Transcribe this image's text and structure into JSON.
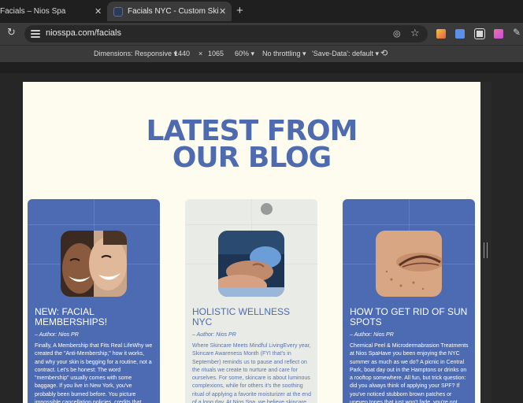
{
  "browser": {
    "tabs": [
      {
        "title": "Facials – Nios Spa",
        "active": false
      },
      {
        "title": "Facials NYC - Custom Skincare & Spa",
        "active": true
      }
    ],
    "address": "niosspa.com/facials"
  },
  "devtools_bar": {
    "dimensions_label": "Dimensions: Responsive ▾",
    "width": "1440",
    "times": "×",
    "height": "1065",
    "zoom": "60% ▾",
    "throttling": "No throttling ▾",
    "save_data": "'Save-Data': default ▾"
  },
  "page": {
    "heading_line1": "LATEST FROM",
    "heading_line2": "OUR BLOG",
    "cards": [
      {
        "title": "NEW: FACIAL MEMBERSHIPS!",
        "author": "– Author: Nios PR",
        "body": "Finally, A Membership that Fits Real LifeWhy we created the \"Anti-Membership,\" how it works, and why your skin is begging for a routine, not a contract. Let's be honest: The word \"membership\" usually comes with some baggage. If you live in New York, you've probably been burned before. You picture impossible cancellation policies, credits that vanish into thin"
      },
      {
        "title": "HOLISTIC WELLNESS NYC",
        "author": "– Author: Nios PR",
        "body": "Where Skincare Meets Mindful LivingEvery year, Skincare Awareness Month (FYI that's in September) reminds us to pause and reflect on the rituals we create to nurture and care for ourselves. For some, skincare is about luminous complexions, while for others it's the soothing ritual of applying a favorite moisturizer at the end of a long day. At Nios Spa, we believe skincare"
      },
      {
        "title": "HOW TO GET RID OF SUN SPOTS",
        "author": "– Author: Nios PR",
        "body": "Chemical Peel & Microdermabrasion Treatments at Nios SpaHave you been enjoying the NYC summer as much as we do? A picnic in Central Park, boat day out in the Hamptons or drinks on a rooftop somewhere. All fun, but trick question: did you always think of applying your SPF? If you've noticed stubborn brown patches or uneven tones that just won't fade, you're not"
      }
    ]
  },
  "colors": {
    "brand_blue": "#4d6bb3",
    "page_bg": "#fdfcee",
    "card_light": "#e9ece6"
  }
}
